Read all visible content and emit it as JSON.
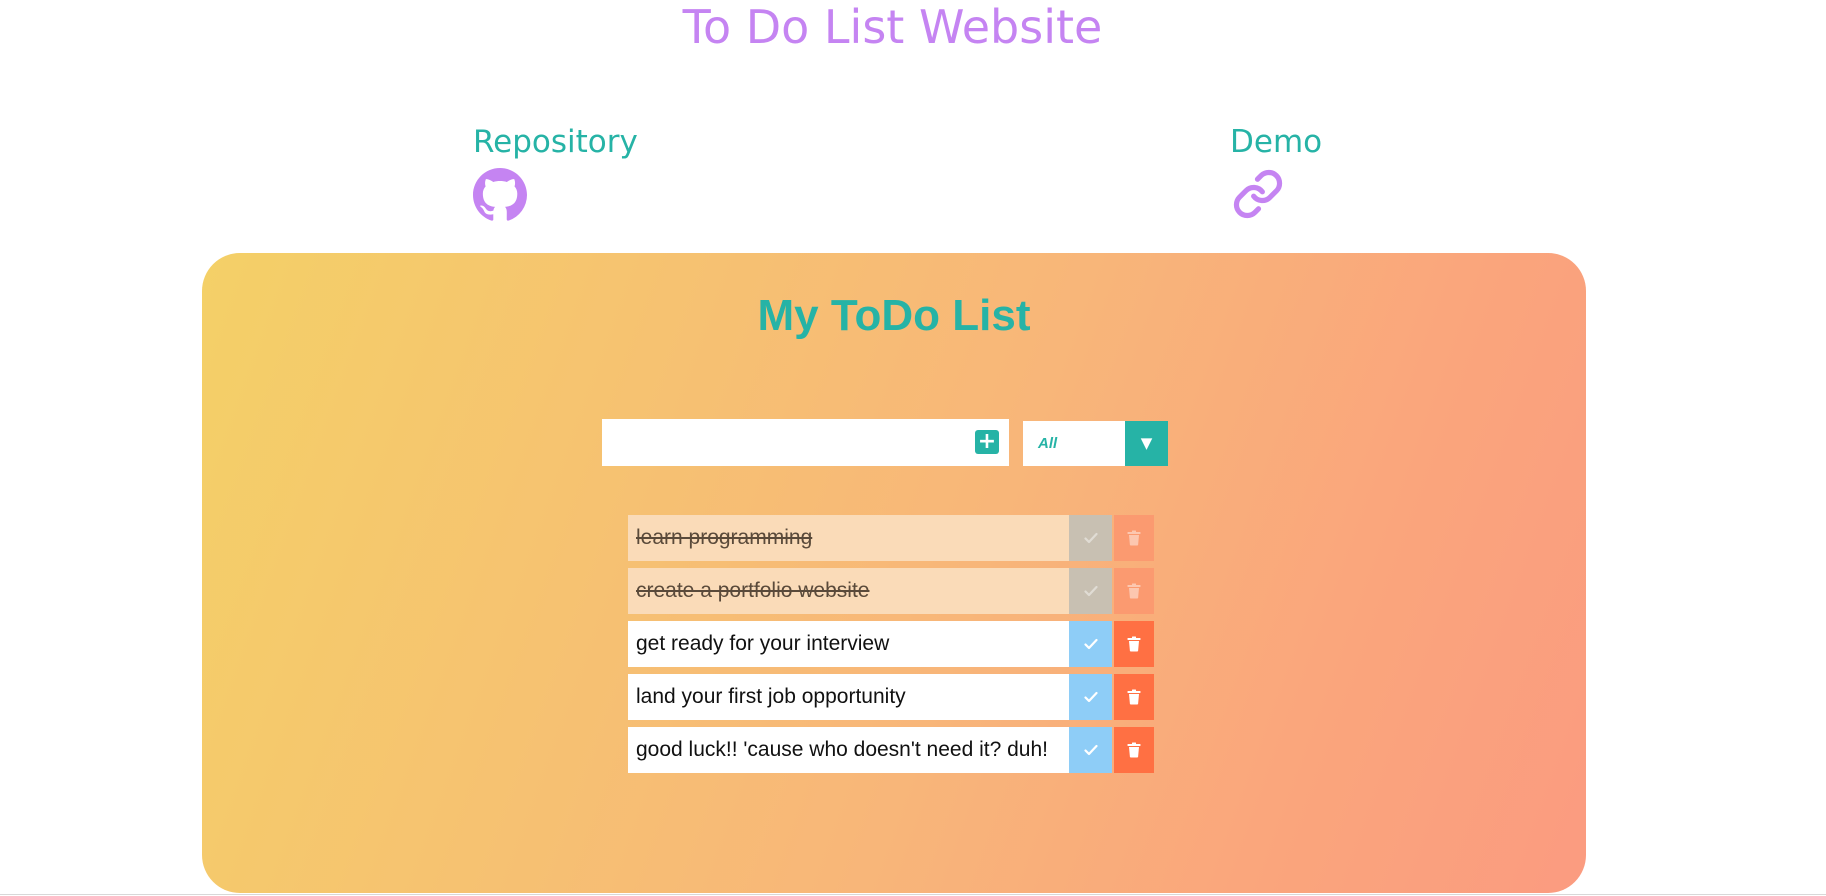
{
  "header": {
    "title": "To Do List Website"
  },
  "links": {
    "repository": {
      "label": "Repository",
      "icon": "github-icon"
    },
    "demo": {
      "label": "Demo",
      "icon": "link-icon"
    }
  },
  "todo_app": {
    "title": "My ToDo List",
    "input": {
      "value": "",
      "placeholder": ""
    },
    "add_button": {
      "label": "+",
      "icon": "plus-icon"
    },
    "filter": {
      "selected": "All",
      "caret": "▼"
    },
    "items": [
      {
        "text": "learn programming",
        "completed": true
      },
      {
        "text": "create a portfolio website",
        "completed": true
      },
      {
        "text": "get ready for your interview",
        "completed": false
      },
      {
        "text": "land your first job opportunity",
        "completed": false
      },
      {
        "text": "good luck!! 'cause who doesn't need it? duh!",
        "completed": false
      }
    ]
  },
  "colors": {
    "title": "#c584f2",
    "link_label": "#26b3a6",
    "icon": "#c584f2",
    "accent": "#26b3a6",
    "check_button": "#8ecdf7",
    "trash_button": "#ff7043",
    "gradient_start": "#f4d067",
    "gradient_end": "#fb9b80"
  }
}
